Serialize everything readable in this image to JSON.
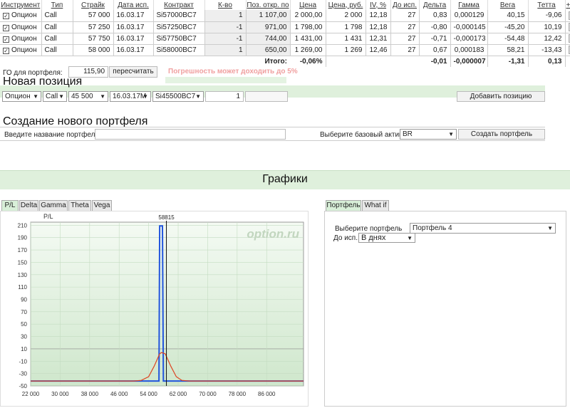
{
  "table": {
    "headers": [
      "Инструмент",
      "Тип",
      "Страйк",
      "Дата исп.",
      "Контракт",
      "К-во",
      "Поз. откр. по",
      "Цена",
      "Цена, руб.",
      "IV, %",
      "До исп.",
      "Дельта",
      "Гамма",
      "Вега",
      "Тетта",
      "+/-"
    ],
    "rows": [
      {
        "instrument": "Опцион",
        "type": "Call",
        "strike": "57 000",
        "date": "16.03.17",
        "contract": "Si57000BC7",
        "qty": "1",
        "open": "1 107,00",
        "price": "2 000,00",
        "price_rub": "2 000",
        "iv": "12,18",
        "days": "27",
        "delta": "0,83",
        "gamma": "0,000129",
        "vega": "40,15",
        "theta": "-9,06"
      },
      {
        "instrument": "Опцион",
        "type": "Call",
        "strike": "57 250",
        "date": "16.03.17",
        "contract": "Si57250BC7",
        "qty": "-1",
        "open": "971,00",
        "price": "1 798,00",
        "price_rub": "1 798",
        "iv": "12,18",
        "days": "27",
        "delta": "-0,80",
        "gamma": "-0,000145",
        "vega": "-45,20",
        "theta": "10,19"
      },
      {
        "instrument": "Опцион",
        "type": "Call",
        "strike": "57 750",
        "date": "16.03.17",
        "contract": "Si57750BC7",
        "qty": "-1",
        "open": "744,00",
        "price": "1 431,00",
        "price_rub": "1 431",
        "iv": "12,31",
        "days": "27",
        "delta": "-0,71",
        "gamma": "-0,000173",
        "vega": "-54,48",
        "theta": "12,42"
      },
      {
        "instrument": "Опцион",
        "type": "Call",
        "strike": "58 000",
        "date": "16.03.17",
        "contract": "Si58000BC7",
        "qty": "1",
        "open": "650,00",
        "price": "1 269,00",
        "price_rub": "1 269",
        "iv": "12,46",
        "days": "27",
        "delta": "0,67",
        "gamma": "0,000183",
        "vega": "58,21",
        "theta": "-13,43"
      }
    ],
    "total_label": "Итого:",
    "total_pct": "-0,06%",
    "total_delta": "-0,01",
    "total_gamma": "-0,000007",
    "total_vega": "-1,31",
    "total_theta": "0,13",
    "remove_icon": "×"
  },
  "go": {
    "label": "ГО для портфеля:",
    "value": "115,90",
    "recalc_button": "пересчитать",
    "warning": "Погрешность может доходить до 5%"
  },
  "new_position": {
    "title": "Новая позиция",
    "instrument": "Опцион",
    "type": "Call",
    "strike": "45 500",
    "date": "16.03.17М",
    "contract": "Si45500BC7",
    "qty": "1",
    "add_button": "Добавить позицию"
  },
  "new_portfolio": {
    "title": "Создание нового портфеля",
    "name_label": "Введите название портфеля",
    "base_label": "Выберите базовый актив",
    "base_value": "BR",
    "create_button": "Создать портфель"
  },
  "charts_title": "Графики",
  "chart_tabs": [
    "P/L",
    "Delta",
    "Gamma",
    "Theta",
    "Vega"
  ],
  "right_tabs": [
    "Портфель",
    "What if"
  ],
  "right_panel": {
    "portfolio_label": "Выберите портфель",
    "portfolio_value": "Портфель 4",
    "until_label": "До исп.:",
    "until_value": "В днях"
  },
  "chart_data": {
    "type": "line",
    "ylabel": "P/L",
    "watermark": "option.ru",
    "marker_label": "58815",
    "marker_x": 58815,
    "xlim": [
      22000,
      96000
    ],
    "ylim": [
      -50,
      215
    ],
    "x_ticks": [
      "22 000",
      "30 000",
      "38 000",
      "46 000",
      "54 000",
      "62 000",
      "70 000",
      "78 000",
      "86 000"
    ],
    "y_ticks": [
      "210",
      "190",
      "170",
      "150",
      "130",
      "110",
      "90",
      "70",
      "50",
      "30",
      "10",
      "-10",
      "-30",
      "-50"
    ],
    "series": [
      {
        "color": "#2255dd",
        "x": [
          22000,
          56600,
          56800,
          57000,
          57250,
          57750,
          58000,
          58200,
          96000
        ],
        "y": [
          -42,
          -42,
          -42,
          209,
          209,
          209,
          -42,
          -42,
          -42
        ]
      },
      {
        "color": "#dd4422",
        "x": [
          22000,
          50000,
          52000,
          54000,
          55500,
          57000,
          57500,
          58500,
          60000,
          61500,
          63000,
          65000,
          96000
        ],
        "y": [
          -42,
          -42,
          -41,
          -35,
          -18,
          2,
          4,
          2,
          -18,
          -35,
          -41,
          -42,
          -42
        ]
      }
    ]
  },
  "colors": {
    "green_bar": "#dff0dc",
    "accent": "#2a7a2a"
  }
}
